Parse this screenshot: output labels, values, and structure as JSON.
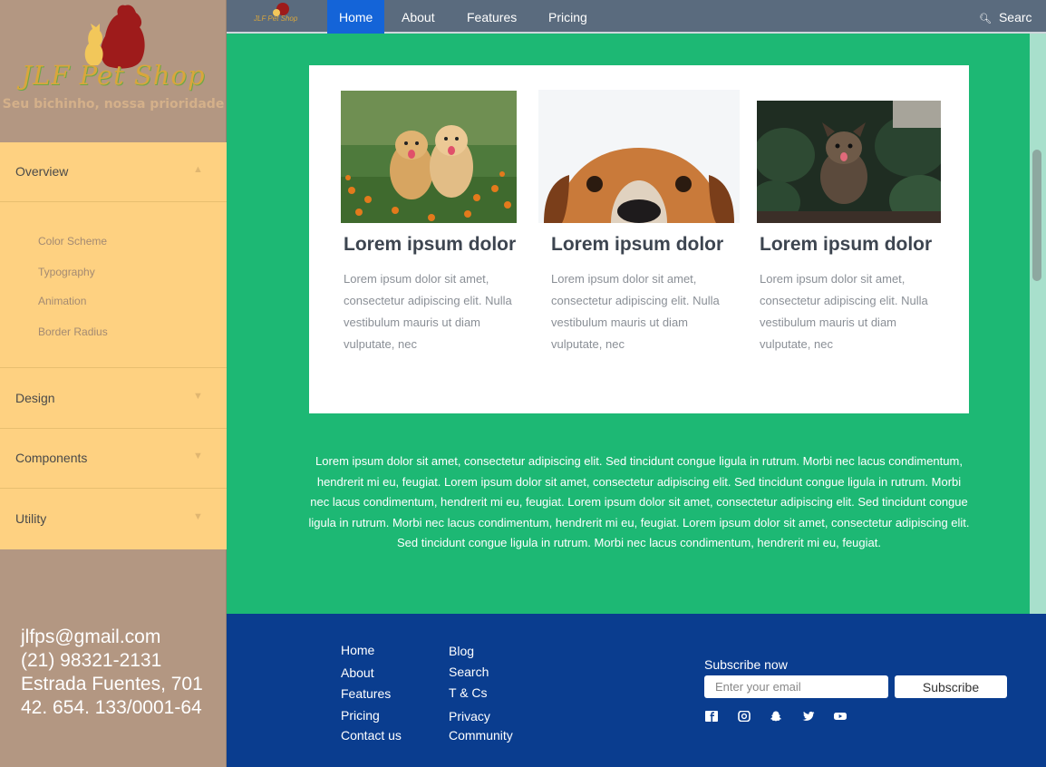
{
  "brand": {
    "name": "JLF Pet Shop",
    "tagline": "Seu bichinho, nossa prioridade"
  },
  "sidebar": {
    "sections": [
      {
        "label": "Overview",
        "expanded": true
      },
      {
        "label": "Design",
        "expanded": false
      },
      {
        "label": "Components",
        "expanded": false
      },
      {
        "label": "Utility",
        "expanded": false
      }
    ],
    "overview_items": [
      "Color Scheme",
      "Typography",
      "Animation",
      "Border Radius"
    ],
    "contact": {
      "email": "jlfps@gmail.com",
      "phone": "(21) 98321-2131",
      "address": "Estrada Fuentes, 701",
      "cnpj": "42. 654. 133/0001-64"
    }
  },
  "navbar": {
    "logo_text": "JLF Pet Shop",
    "items": [
      "Home",
      "About",
      "Features",
      "Pricing"
    ],
    "active": "Home",
    "search_label": "Searc"
  },
  "cards": [
    {
      "title": "Lorem ipsum dolor",
      "text": "Lorem ipsum dolor sit amet, consectetur adipiscing elit. Nulla vestibulum mauris ut diam vulputate, nec",
      "image": "two-puppies-photo"
    },
    {
      "title": "Lorem ipsum dolor",
      "text": "Lorem ipsum dolor sit amet, consectetur adipiscing elit. Nulla vestibulum mauris ut diam vulputate, nec",
      "image": "dog-face-peeking-photo"
    },
    {
      "title": "Lorem ipsum dolor",
      "text": "Lorem ipsum dolor sit amet, consectetur adipiscing elit. Nulla vestibulum mauris ut diam vulputate, nec",
      "image": "terrier-in-plants-photo"
    }
  ],
  "lorem_paragraph": "Lorem ipsum dolor sit amet, consectetur adipiscing elit. Sed tincidunt congue ligula in rutrum. Morbi nec lacus condimentum, hendrerit mi eu, feugiat. Lorem ipsum dolor sit amet, consectetur adipiscing elit. Sed tincidunt congue ligula in rutrum. Morbi nec lacus condimentum, hendrerit mi eu, feugiat.  Lorem ipsum dolor sit amet, consectetur adipiscing elit. Sed tincidunt congue ligula in rutrum. Morbi nec lacus condimentum, hendrerit mi eu, feugiat.  Lorem ipsum dolor sit amet, consectetur adipiscing elit. Sed tincidunt congue ligula in rutrum. Morbi nec lacus condimentum, hendrerit mi eu, feugiat.",
  "footer": {
    "col1": [
      "Home",
      "About",
      "Features",
      "Pricing",
      "Contact us"
    ],
    "col2": [
      "Blog",
      "Search",
      "T & Cs",
      "Privacy",
      "Community"
    ],
    "subscribe_label": "Subscribe now",
    "email_placeholder": "Enter your email",
    "subscribe_button": "Subscribe",
    "social_icons": [
      "facebook-icon",
      "instagram-icon",
      "snapchat-icon",
      "twitter-icon",
      "youtube-icon"
    ]
  },
  "colors": {
    "sidebar_bg": "#b39782",
    "menu_bg": "#fed181",
    "main_bg": "#1db874",
    "navbar_bg": "#5a6b7e",
    "nav_active": "#1464d8",
    "footer_bg": "#0a3d8f"
  }
}
